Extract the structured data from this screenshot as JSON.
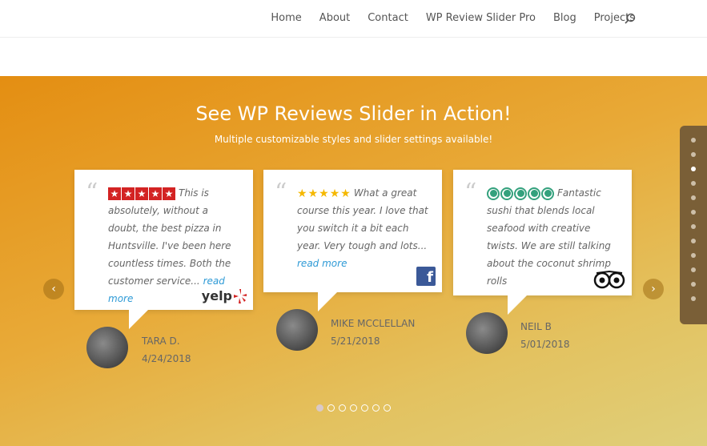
{
  "nav": {
    "items": [
      "Home",
      "About",
      "Contact",
      "WP Review Slider Pro",
      "Blog",
      "Projects"
    ],
    "search_icon": "search-icon"
  },
  "hero": {
    "title": "See WP Reviews Slider in Action!",
    "subtitle": "Multiple customizable styles and slider settings available!"
  },
  "reviews": [
    {
      "source": "yelp",
      "rating": 5,
      "text": "This is absolutely, without a doubt, the best pizza in Huntsville. I've been here countless times. Both the customer service...",
      "read_more": "read more",
      "brand_label": "yelp",
      "name": "TARA D.",
      "date": "4/24/2018"
    },
    {
      "source": "facebook",
      "rating": 5,
      "text": "What a great course this year. I love that you switch it a bit each year. Very tough and lots...",
      "read_more": "read more",
      "brand_label": "f",
      "name": "MIKE MCCLELLAN",
      "date": "5/21/2018"
    },
    {
      "source": "tripadvisor",
      "rating": 5,
      "text": "Fantastic sushi that blends local seafood with creative twists. We are still talking about the coconut shrimp rolls",
      "name": "NEIL B",
      "date": "5/01/2018"
    }
  ],
  "slider": {
    "prev_icon": "chevron-left-icon",
    "next_icon": "chevron-right-icon",
    "pages": 7,
    "active_page": 1
  },
  "side_nav": {
    "dots": 12,
    "active_dot": 3
  },
  "colors": {
    "accent_link": "#2e9ad6",
    "yelp_red": "#d32323",
    "fb_blue": "#3b5998",
    "ta_green": "#34a17d"
  }
}
